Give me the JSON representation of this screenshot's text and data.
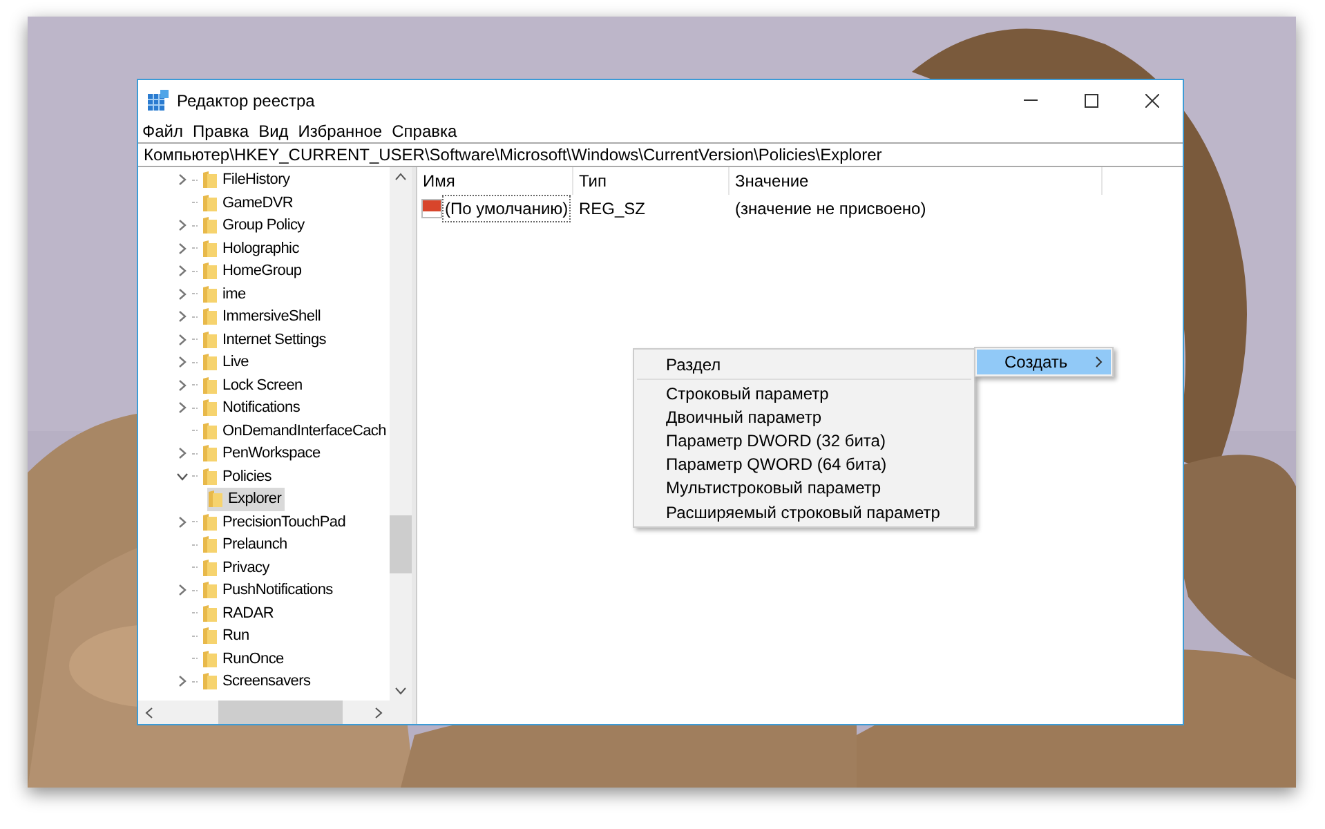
{
  "window": {
    "title": "Редактор реестра"
  },
  "menu_bar": [
    "Файл",
    "Правка",
    "Вид",
    "Избранное",
    "Справка"
  ],
  "address_bar": "Компьютер\\HKEY_CURRENT_USER\\Software\\Microsoft\\Windows\\CurrentVersion\\Policies\\Explorer",
  "tree": [
    {
      "label": "FileHistory",
      "has_children": true,
      "expanded": false,
      "selected": false
    },
    {
      "label": "GameDVR",
      "has_children": false,
      "selected": false
    },
    {
      "label": "Group Policy",
      "has_children": true,
      "expanded": false,
      "selected": false
    },
    {
      "label": "Holographic",
      "has_children": true,
      "expanded": false,
      "selected": false
    },
    {
      "label": "HomeGroup",
      "has_children": true,
      "expanded": false,
      "selected": false
    },
    {
      "label": "ime",
      "has_children": true,
      "expanded": false,
      "selected": false
    },
    {
      "label": "ImmersiveShell",
      "has_children": true,
      "expanded": false,
      "selected": false
    },
    {
      "label": "Internet Settings",
      "has_children": true,
      "expanded": false,
      "selected": false
    },
    {
      "label": "Live",
      "has_children": true,
      "expanded": false,
      "selected": false
    },
    {
      "label": "Lock Screen",
      "has_children": true,
      "expanded": false,
      "selected": false
    },
    {
      "label": "Notifications",
      "has_children": true,
      "expanded": false,
      "selected": false
    },
    {
      "label": "OnDemandInterfaceCach",
      "has_children": false,
      "selected": false
    },
    {
      "label": "PenWorkspace",
      "has_children": true,
      "expanded": false,
      "selected": false
    },
    {
      "label": "Policies",
      "has_children": true,
      "expanded": true,
      "selected": false,
      "children": [
        {
          "label": "Explorer",
          "has_children": false,
          "selected": true
        }
      ]
    },
    {
      "label": "PrecisionTouchPad",
      "has_children": true,
      "expanded": false,
      "selected": false
    },
    {
      "label": "Prelaunch",
      "has_children": false,
      "selected": false
    },
    {
      "label": "Privacy",
      "has_children": false,
      "selected": false
    },
    {
      "label": "PushNotifications",
      "has_children": true,
      "expanded": false,
      "selected": false
    },
    {
      "label": "RADAR",
      "has_children": false,
      "selected": false
    },
    {
      "label": "Run",
      "has_children": false,
      "selected": false
    },
    {
      "label": "RunOnce",
      "has_children": false,
      "selected": false
    },
    {
      "label": "Screensavers",
      "has_children": true,
      "expanded": false,
      "selected": false
    }
  ],
  "table": {
    "columns": [
      "Имя",
      "Тип",
      "Значение"
    ],
    "rows": [
      {
        "name": "(По умолчанию)",
        "type": "REG_SZ",
        "value": "(значение не присвоено)"
      }
    ]
  },
  "context_menu": {
    "items": [
      {
        "label": "Создать",
        "selected": true,
        "submenu": [
          {
            "kind": "item",
            "label": "Раздел"
          },
          {
            "kind": "separator"
          },
          {
            "kind": "item",
            "label": "Строковый параметр"
          },
          {
            "kind": "item",
            "label": "Двоичный параметр"
          },
          {
            "kind": "item",
            "label": "Параметр DWORD (32 бита)"
          },
          {
            "kind": "item",
            "label": "Параметр QWORD (64 бита)"
          },
          {
            "kind": "item",
            "label": "Мультистроковый параметр"
          },
          {
            "kind": "item",
            "label": "Расширяемый строковый параметр"
          }
        ]
      }
    ]
  }
}
